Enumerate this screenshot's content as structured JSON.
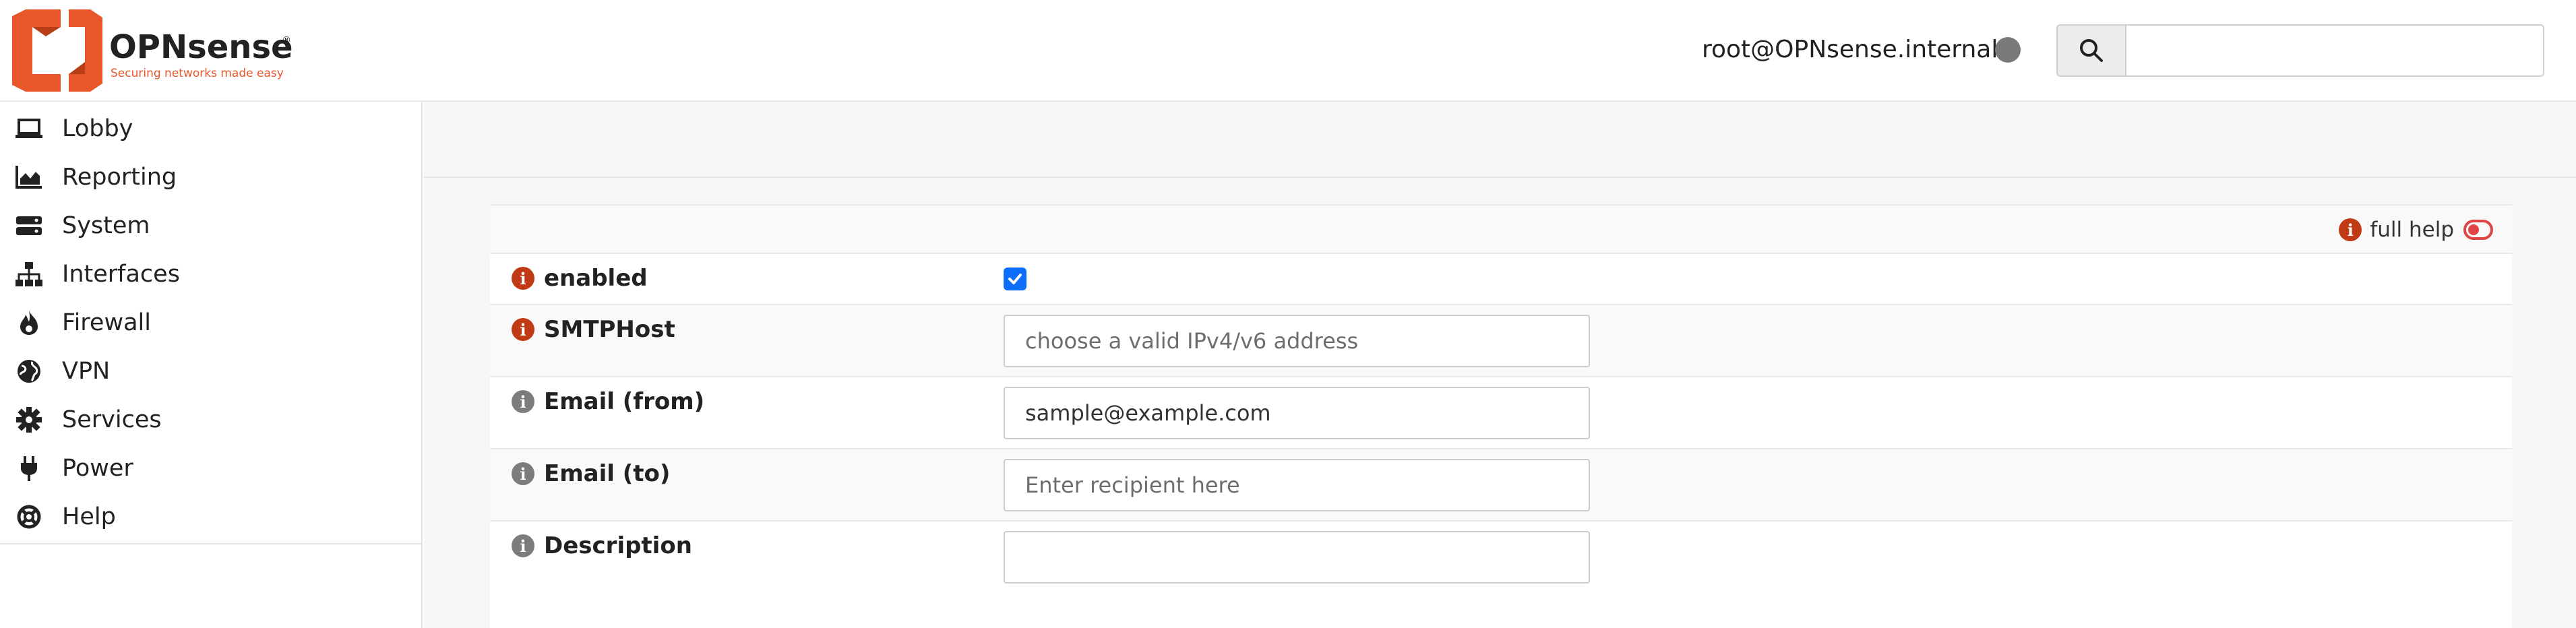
{
  "header": {
    "brand": "OPNsense",
    "tagline": "Securing networks made easy",
    "user": "root@OPNsense.internal",
    "search_value": ""
  },
  "sidebar": {
    "items": [
      {
        "label": "Lobby",
        "icon": "laptop-icon"
      },
      {
        "label": "Reporting",
        "icon": "area-chart-icon"
      },
      {
        "label": "System",
        "icon": "server-icon"
      },
      {
        "label": "Interfaces",
        "icon": "sitemap-icon"
      },
      {
        "label": "Firewall",
        "icon": "fire-icon"
      },
      {
        "label": "VPN",
        "icon": "globe-icon"
      },
      {
        "label": "Services",
        "icon": "gear-icon"
      },
      {
        "label": "Power",
        "icon": "plug-icon"
      },
      {
        "label": "Help",
        "icon": "life-ring-icon"
      }
    ]
  },
  "form": {
    "full_help_label": "full help",
    "enabled": {
      "label": "enabled",
      "checked": true
    },
    "smtp_host": {
      "label": "SMTPHost",
      "value": "",
      "placeholder": "choose a valid IPv4/v6 address"
    },
    "email_from": {
      "label": "Email (from)",
      "value": "sample@example.com",
      "placeholder": ""
    },
    "email_to": {
      "label": "Email (to)",
      "value": "",
      "placeholder": "Enter recipient here"
    },
    "description": {
      "label": "Description",
      "value": "",
      "placeholder": ""
    }
  },
  "colors": {
    "brand_orange": "#e8562a",
    "info_red": "#c03b15",
    "info_gray": "#7c7c7c",
    "checkbox_blue": "#0d6efd",
    "toggle_red": "#e04545"
  }
}
